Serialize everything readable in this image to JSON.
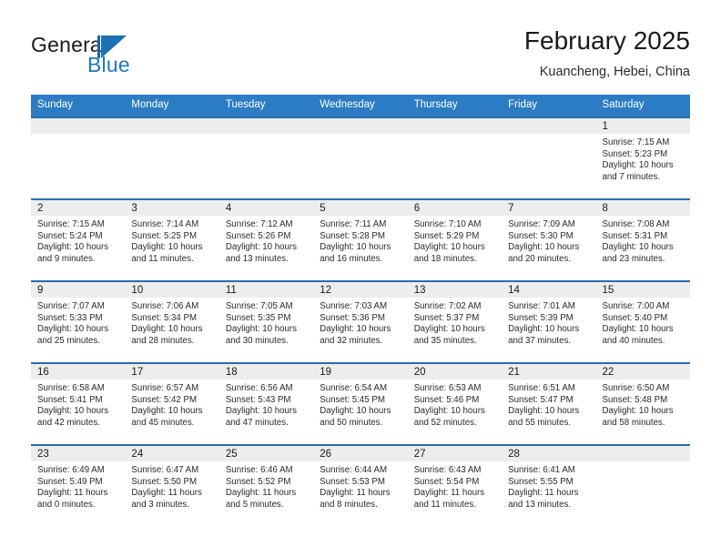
{
  "brand": {
    "name_part1": "General",
    "name_part2": "Blue"
  },
  "header": {
    "title": "February 2025",
    "location": "Kuancheng, Hebei, China"
  },
  "colors": {
    "header_blue": "#2b7cc4",
    "row_divider_blue": "#2b6cb0",
    "brand_blue": "#1f77c2",
    "day_head_shaded": "#ededed",
    "day_head_plain": "#f7f7f7"
  },
  "weekday_headers": [
    "Sunday",
    "Monday",
    "Tuesday",
    "Wednesday",
    "Thursday",
    "Friday",
    "Saturday"
  ],
  "weeks": [
    {
      "shaded": true,
      "days": [
        {
          "number": "",
          "sunrise": "",
          "sunset": "",
          "daylight": "",
          "empty": true
        },
        {
          "number": "",
          "sunrise": "",
          "sunset": "",
          "daylight": "",
          "empty": true
        },
        {
          "number": "",
          "sunrise": "",
          "sunset": "",
          "daylight": "",
          "empty": true
        },
        {
          "number": "",
          "sunrise": "",
          "sunset": "",
          "daylight": "",
          "empty": true
        },
        {
          "number": "",
          "sunrise": "",
          "sunset": "",
          "daylight": "",
          "empty": true
        },
        {
          "number": "",
          "sunrise": "",
          "sunset": "",
          "daylight": "",
          "empty": true
        },
        {
          "number": "1",
          "sunrise": "Sunrise: 7:15 AM",
          "sunset": "Sunset: 5:23 PM",
          "daylight": "Daylight: 10 hours and 7 minutes.",
          "empty": false
        }
      ]
    },
    {
      "shaded": true,
      "days": [
        {
          "number": "2",
          "sunrise": "Sunrise: 7:15 AM",
          "sunset": "Sunset: 5:24 PM",
          "daylight": "Daylight: 10 hours and 9 minutes.",
          "empty": false
        },
        {
          "number": "3",
          "sunrise": "Sunrise: 7:14 AM",
          "sunset": "Sunset: 5:25 PM",
          "daylight": "Daylight: 10 hours and 11 minutes.",
          "empty": false
        },
        {
          "number": "4",
          "sunrise": "Sunrise: 7:12 AM",
          "sunset": "Sunset: 5:26 PM",
          "daylight": "Daylight: 10 hours and 13 minutes.",
          "empty": false
        },
        {
          "number": "5",
          "sunrise": "Sunrise: 7:11 AM",
          "sunset": "Sunset: 5:28 PM",
          "daylight": "Daylight: 10 hours and 16 minutes.",
          "empty": false
        },
        {
          "number": "6",
          "sunrise": "Sunrise: 7:10 AM",
          "sunset": "Sunset: 5:29 PM",
          "daylight": "Daylight: 10 hours and 18 minutes.",
          "empty": false
        },
        {
          "number": "7",
          "sunrise": "Sunrise: 7:09 AM",
          "sunset": "Sunset: 5:30 PM",
          "daylight": "Daylight: 10 hours and 20 minutes.",
          "empty": false
        },
        {
          "number": "8",
          "sunrise": "Sunrise: 7:08 AM",
          "sunset": "Sunset: 5:31 PM",
          "daylight": "Daylight: 10 hours and 23 minutes.",
          "empty": false
        }
      ]
    },
    {
      "shaded": true,
      "days": [
        {
          "number": "9",
          "sunrise": "Sunrise: 7:07 AM",
          "sunset": "Sunset: 5:33 PM",
          "daylight": "Daylight: 10 hours and 25 minutes.",
          "empty": false
        },
        {
          "number": "10",
          "sunrise": "Sunrise: 7:06 AM",
          "sunset": "Sunset: 5:34 PM",
          "daylight": "Daylight: 10 hours and 28 minutes.",
          "empty": false
        },
        {
          "number": "11",
          "sunrise": "Sunrise: 7:05 AM",
          "sunset": "Sunset: 5:35 PM",
          "daylight": "Daylight: 10 hours and 30 minutes.",
          "empty": false
        },
        {
          "number": "12",
          "sunrise": "Sunrise: 7:03 AM",
          "sunset": "Sunset: 5:36 PM",
          "daylight": "Daylight: 10 hours and 32 minutes.",
          "empty": false
        },
        {
          "number": "13",
          "sunrise": "Sunrise: 7:02 AM",
          "sunset": "Sunset: 5:37 PM",
          "daylight": "Daylight: 10 hours and 35 minutes.",
          "empty": false
        },
        {
          "number": "14",
          "sunrise": "Sunrise: 7:01 AM",
          "sunset": "Sunset: 5:39 PM",
          "daylight": "Daylight: 10 hours and 37 minutes.",
          "empty": false
        },
        {
          "number": "15",
          "sunrise": "Sunrise: 7:00 AM",
          "sunset": "Sunset: 5:40 PM",
          "daylight": "Daylight: 10 hours and 40 minutes.",
          "empty": false
        }
      ]
    },
    {
      "shaded": true,
      "days": [
        {
          "number": "16",
          "sunrise": "Sunrise: 6:58 AM",
          "sunset": "Sunset: 5:41 PM",
          "daylight": "Daylight: 10 hours and 42 minutes.",
          "empty": false
        },
        {
          "number": "17",
          "sunrise": "Sunrise: 6:57 AM",
          "sunset": "Sunset: 5:42 PM",
          "daylight": "Daylight: 10 hours and 45 minutes.",
          "empty": false
        },
        {
          "number": "18",
          "sunrise": "Sunrise: 6:56 AM",
          "sunset": "Sunset: 5:43 PM",
          "daylight": "Daylight: 10 hours and 47 minutes.",
          "empty": false
        },
        {
          "number": "19",
          "sunrise": "Sunrise: 6:54 AM",
          "sunset": "Sunset: 5:45 PM",
          "daylight": "Daylight: 10 hours and 50 minutes.",
          "empty": false
        },
        {
          "number": "20",
          "sunrise": "Sunrise: 6:53 AM",
          "sunset": "Sunset: 5:46 PM",
          "daylight": "Daylight: 10 hours and 52 minutes.",
          "empty": false
        },
        {
          "number": "21",
          "sunrise": "Sunrise: 6:51 AM",
          "sunset": "Sunset: 5:47 PM",
          "daylight": "Daylight: 10 hours and 55 minutes.",
          "empty": false
        },
        {
          "number": "22",
          "sunrise": "Sunrise: 6:50 AM",
          "sunset": "Sunset: 5:48 PM",
          "daylight": "Daylight: 10 hours and 58 minutes.",
          "empty": false
        }
      ]
    },
    {
      "shaded": true,
      "days": [
        {
          "number": "23",
          "sunrise": "Sunrise: 6:49 AM",
          "sunset": "Sunset: 5:49 PM",
          "daylight": "Daylight: 11 hours and 0 minutes.",
          "empty": false
        },
        {
          "number": "24",
          "sunrise": "Sunrise: 6:47 AM",
          "sunset": "Sunset: 5:50 PM",
          "daylight": "Daylight: 11 hours and 3 minutes.",
          "empty": false
        },
        {
          "number": "25",
          "sunrise": "Sunrise: 6:46 AM",
          "sunset": "Sunset: 5:52 PM",
          "daylight": "Daylight: 11 hours and 5 minutes.",
          "empty": false
        },
        {
          "number": "26",
          "sunrise": "Sunrise: 6:44 AM",
          "sunset": "Sunset: 5:53 PM",
          "daylight": "Daylight: 11 hours and 8 minutes.",
          "empty": false
        },
        {
          "number": "27",
          "sunrise": "Sunrise: 6:43 AM",
          "sunset": "Sunset: 5:54 PM",
          "daylight": "Daylight: 11 hours and 11 minutes.",
          "empty": false
        },
        {
          "number": "28",
          "sunrise": "Sunrise: 6:41 AM",
          "sunset": "Sunset: 5:55 PM",
          "daylight": "Daylight: 11 hours and 13 minutes.",
          "empty": false
        },
        {
          "number": "",
          "sunrise": "",
          "sunset": "",
          "daylight": "",
          "empty": true
        }
      ]
    }
  ]
}
